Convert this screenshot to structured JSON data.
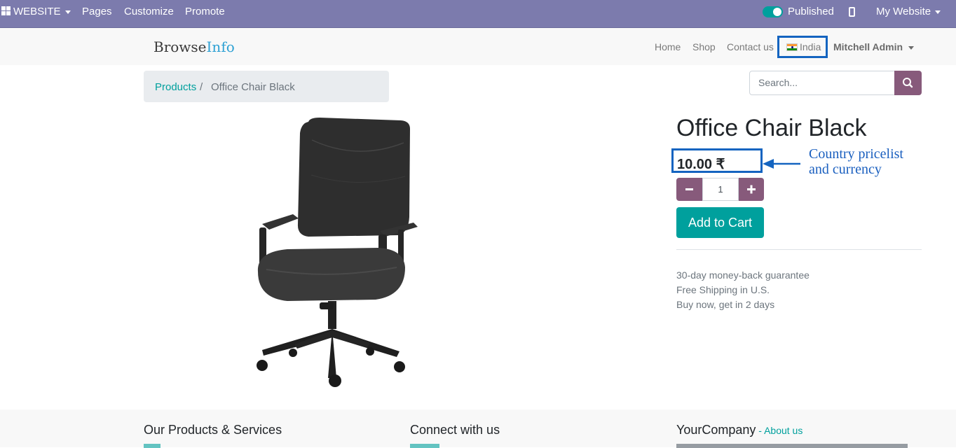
{
  "admin_bar": {
    "website_menu": "WEBSITE",
    "pages": "Pages",
    "customize": "Customize",
    "promote": "Promote",
    "published_label": "Published",
    "site_selector": "My Website"
  },
  "site_header": {
    "logo_primary": "Browse",
    "logo_accent": "Info",
    "nav": [
      "Home",
      "Shop",
      "Contact us"
    ],
    "country": "India",
    "user": "Mitchell Admin"
  },
  "breadcrumb": {
    "parent": "Products",
    "separator": "/",
    "current": "Office Chair Black"
  },
  "search": {
    "placeholder": "Search..."
  },
  "product": {
    "title": "Office Chair Black",
    "price": "10.00 ₹",
    "quantity": "1",
    "add_to_cart": "Add to Cart",
    "guarantees": [
      "30-day money-back guarantee",
      "Free Shipping in U.S.",
      "Buy now, get in 2 days"
    ]
  },
  "annotation": {
    "line1": "Country pricelist",
    "line2": "and currency"
  },
  "footer": {
    "col1_heading": "Our Products & Services",
    "col2_heading": "Connect with us",
    "col3_heading": "YourCompany",
    "col3_link_sep": " - ",
    "col3_link": "About us"
  },
  "colors": {
    "admin_bar": "#7c7bad",
    "primary_teal": "#00a09d",
    "secondary_purple": "#875a7b",
    "annotation_blue": "#1464c0"
  }
}
